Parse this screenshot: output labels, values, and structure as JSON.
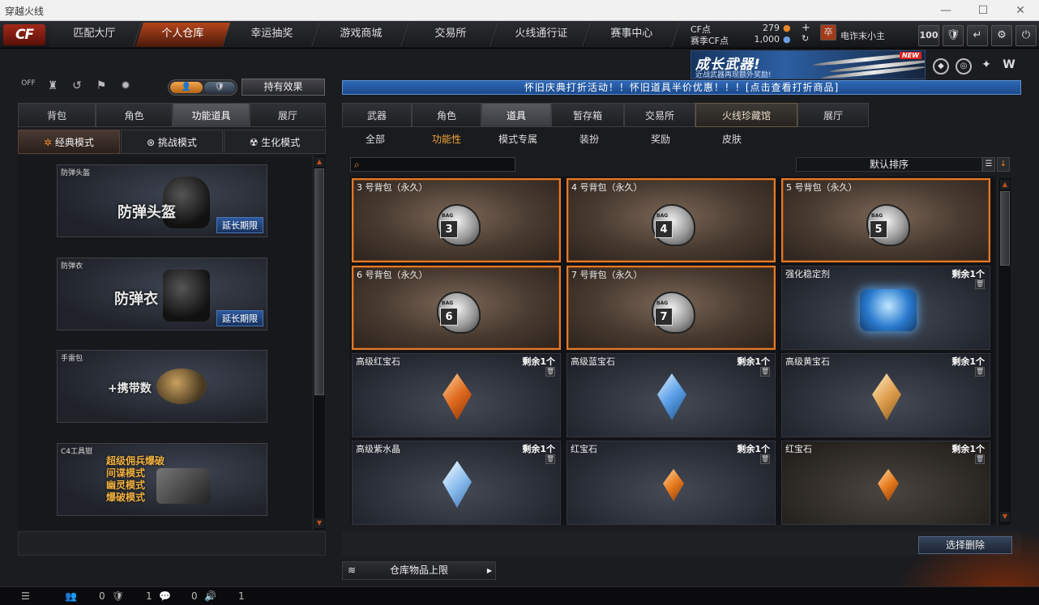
{
  "window": {
    "title": "穿越火线"
  },
  "nav": {
    "tabs": [
      "匹配大厅",
      "个人仓库",
      "幸运抽奖",
      "游戏商城",
      "交易所",
      "火线通行证",
      "赛事中心"
    ],
    "active_index": 1
  },
  "account": {
    "cf_label": "CF点",
    "cf_value": "279",
    "season_label": "赛季CF点",
    "season_value": "1,000",
    "username": "电诈末小主",
    "level": "100"
  },
  "banner": {
    "title": "成长武器!",
    "sub": "近战武器再现额外奖励!",
    "badge": "NEW"
  },
  "left": {
    "toggle_left": "👤",
    "toggle_right": "🛡",
    "effects_button": "持有效果",
    "tabs": [
      "背包",
      "角色",
      "功能道具",
      "展厅"
    ],
    "active_tab": 2,
    "modes": [
      "经典模式",
      "挑战模式",
      "生化模式"
    ],
    "items": [
      {
        "label": "防弹头盔",
        "big": "防弹头盔",
        "ext": "延长期限"
      },
      {
        "label": "防弹衣",
        "big": "防弹衣",
        "ext": "延长期限"
      },
      {
        "label": "手雷包",
        "big": "+携带数"
      },
      {
        "label": "C4工具钳",
        "lines": [
          "超级佣兵爆破",
          "间谍模式",
          "幽灵模式",
          "爆破模式"
        ]
      }
    ]
  },
  "promo": "怀旧庆典打折活动！！怀旧道具半价优惠！！！[点击查看打折商品]",
  "right": {
    "tabs": [
      "武器",
      "角色",
      "道具",
      "暂存箱",
      "交易所",
      "火线珍藏馆",
      "展厅"
    ],
    "active_tab": 2,
    "subtabs": [
      "全部",
      "功能性",
      "模式专属",
      "装扮",
      "奖励",
      "皮肤"
    ],
    "active_sub": 1,
    "search_placeholder": "",
    "sort": "默认排序",
    "items": [
      {
        "name": "3 号背包（永久）",
        "num": "3"
      },
      {
        "name": "4 号背包（永久）",
        "num": "4"
      },
      {
        "name": "5 号背包（永久）",
        "num": "5"
      },
      {
        "name": "6 号背包（永久）",
        "num": "6"
      },
      {
        "name": "7 号背包（永久）",
        "num": "7"
      },
      {
        "name": "强化稳定剂",
        "qty": "剩余1个"
      },
      {
        "name": "高级红宝石",
        "qty": "剩余1个",
        "color": "#e06a1e"
      },
      {
        "name": "高级蓝宝石",
        "qty": "剩余1个",
        "color": "#5aa0e8"
      },
      {
        "name": "高级黄宝石",
        "qty": "剩余1个",
        "color": "#e0a050"
      },
      {
        "name": "高级紫水晶",
        "qty": "剩余1个",
        "color": "#8fc0f0"
      },
      {
        "name": "红宝石",
        "qty": "剩余1个",
        "color": "#e67a1e"
      },
      {
        "name": "红宝石",
        "qty": "剩余1个",
        "color": "#e67a1e"
      }
    ],
    "delete_button": "选择删除",
    "capacity_button": "仓库物品上限"
  },
  "status": {
    "friends": "0",
    "shield": "1",
    "messages": "0",
    "volume": "1"
  }
}
